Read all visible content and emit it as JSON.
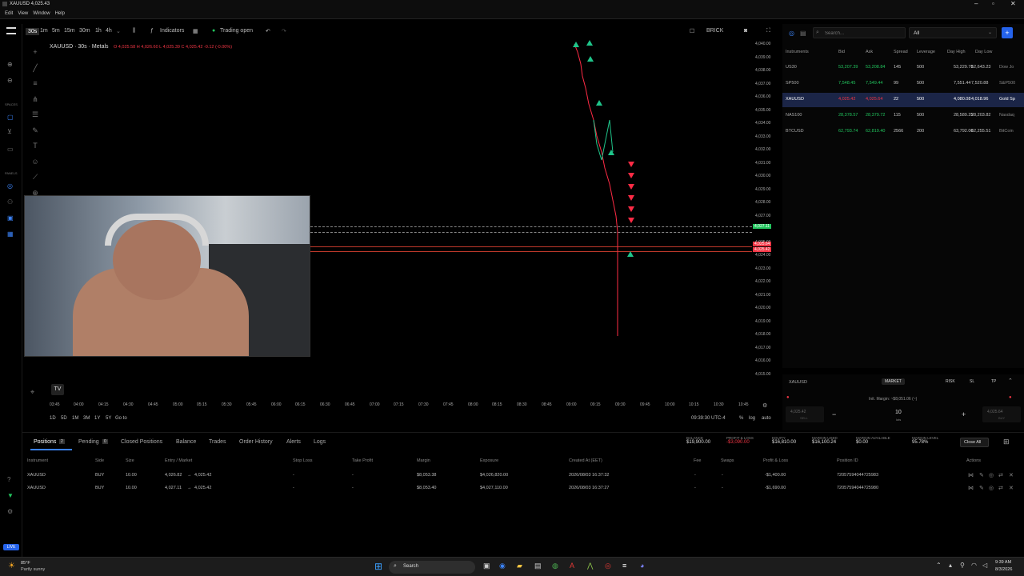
{
  "window": {
    "title": "XAUUSD 4,025.43",
    "menu": [
      "Edit",
      "View",
      "Window",
      "Help"
    ]
  },
  "toolbar": {
    "timeframes": [
      "30s",
      "1m",
      "5m",
      "15m",
      "30m",
      "1h",
      "4h"
    ],
    "indicators_label": "Indicators",
    "trading_status": "Trading open",
    "chart_type": "BRICK"
  },
  "chart": {
    "symbol_line": "XAUUSD · 30s · Metals",
    "ohlc": "O 4,025.58  H 4,026.60  L 4,025.39  C 4,025.42  -0.12 (-0.00%)",
    "price_labels": [
      "4,040.00",
      "4,039.00",
      "4,038.00",
      "4,037.00",
      "4,036.00",
      "4,035.00",
      "4,034.00",
      "4,033.00",
      "4,032.00",
      "4,031.00",
      "4,030.00",
      "4,029.00",
      "4,028.00",
      "4,027.00",
      "4,026.00",
      "4,025.00",
      "4,024.00",
      "4,023.00",
      "4,022.00",
      "4,021.00",
      "4,020.00",
      "4,019.00",
      "4,018.00",
      "4,017.00",
      "4,016.00",
      "4,015.00"
    ],
    "ask_tag": "4,027.11",
    "bid_tag": "4,025.64",
    "bid_tag2": "4,025.42",
    "time_labels": [
      "03:45",
      "04:00",
      "04:15",
      "04:30",
      "04:45",
      "05:00",
      "05:15",
      "05:30",
      "05:45",
      "06:00",
      "06:15",
      "06:30",
      "06:45",
      "07:00",
      "07:15",
      "07:30",
      "07:45",
      "08:00",
      "08:15",
      "08:30",
      "08:45",
      "09:00",
      "09:15",
      "09:30",
      "09:45",
      "10:00",
      "10:15",
      "10:30",
      "10:45"
    ],
    "ranges": [
      "1D",
      "5D",
      "1M",
      "3M",
      "1Y",
      "5Y",
      "Go to"
    ],
    "clock": "09:39:30 UTC-4",
    "scale_opts": [
      "%",
      "log",
      "auto"
    ]
  },
  "watchlist": {
    "search_placeholder": "Search...",
    "filter": "All",
    "headers": [
      "Instruments",
      "Bid",
      "Ask",
      "Spread",
      "Leverage",
      "Day High",
      "Day Low"
    ],
    "rows": [
      {
        "sym": "US30",
        "bid": "53,207.39",
        "ask": "53,208.84",
        "spread": "145",
        "lev": "500",
        "high": "53,229.78",
        "low": "52,643.23",
        "desc": "Dow Jo"
      },
      {
        "sym": "SP500",
        "bid": "7,548.45",
        "ask": "7,549.44",
        "spread": "99",
        "lev": "500",
        "high": "7,551.44",
        "low": "7,520.88",
        "desc": "S&P500"
      },
      {
        "sym": "XAUUSD",
        "bid": "4,025.42",
        "ask": "4,025.64",
        "spread": "22",
        "lev": "500",
        "high": "4,080.08",
        "low": "4,018.96",
        "desc": "Gold Sp"
      },
      {
        "sym": "NAS100",
        "bid": "28,378.57",
        "ask": "28,379.72",
        "spread": "115",
        "lev": "500",
        "high": "28,589.25",
        "low": "28,203.82",
        "desc": "Nasdaq"
      },
      {
        "sym": "BTCUSD",
        "bid": "62,793.74",
        "ask": "62,819.40",
        "spread": "2566",
        "lev": "200",
        "high": "63,792.00",
        "low": "62,255.51",
        "desc": "BitCoin"
      }
    ]
  },
  "order": {
    "symbol": "XAUUSD",
    "type": "MARKET",
    "risk": "RISK",
    "sl": "SL",
    "tp": "TP",
    "margin": "Init. Margin: ~$8,051.06 (~)",
    "sell_price": "4,025.42",
    "buy_price": "4,025.64",
    "lots": "10",
    "lots_label": "lots",
    "sell": "SELL",
    "buy": "BUY"
  },
  "positions": {
    "tabs": [
      "Positions",
      "Pending",
      "Closed Positions",
      "Balance",
      "Trades",
      "Order History",
      "Alerts",
      "Logs"
    ],
    "positions_count": "2",
    "pending_count": "0",
    "summary": [
      {
        "label": "BALANCE",
        "value": "$19,900.00",
        "color": "#ddd"
      },
      {
        "label": "PROFIT & LOSS",
        "value": "-$3,090.00",
        "color": "#f23645"
      },
      {
        "label": "EQUITY",
        "value": "$16,810.00",
        "color": "#ddd"
      },
      {
        "label": "MARGIN USED",
        "value": "$16,100.24",
        "color": "#ddd"
      },
      {
        "label": "MARGIN AVAILABLE",
        "value": "$0.00",
        "color": "#ddd"
      },
      {
        "label": "MARGIN LEVEL",
        "value": "95.78%",
        "color": "#ddd"
      }
    ],
    "close_all": "Close All",
    "columns": [
      "Instrument",
      "Side",
      "Size",
      "Entry / Market",
      "Stop Loss",
      "Take Profit",
      "Margin",
      "Exposure",
      "Created At (EET)",
      "Fee",
      "Swaps",
      "Profit & Loss",
      "Position ID",
      "Actions"
    ],
    "rows": [
      {
        "inst": "XAUUSD",
        "side": "BUY",
        "size": "10.00",
        "entry": "4,026.82",
        "market": "4,025.42",
        "sl": "-",
        "tp": "-",
        "margin": "$8,053.38",
        "exposure": "$4,026,820.00",
        "created": "2026/08/03 16:37:32",
        "fee": "-",
        "swaps": "-",
        "pnl": "-$1,400.00",
        "id": "72057594044725983"
      },
      {
        "inst": "XAUUSD",
        "side": "BUY",
        "size": "10.00",
        "entry": "4,027.11",
        "market": "4,025.42",
        "sl": "-",
        "tp": "-",
        "margin": "$8,053.40",
        "exposure": "$4,027,110.00",
        "created": "2026/08/03 16:37:27",
        "fee": "-",
        "swaps": "-",
        "pnl": "-$1,690.00",
        "id": "72057594044725980"
      }
    ]
  },
  "taskbar": {
    "weather_temp": "85°F",
    "weather_desc": "Partly sunny",
    "search": "Search",
    "time": "9:39 AM",
    "date": "8/3/2026"
  },
  "live_badge": "LIVE"
}
